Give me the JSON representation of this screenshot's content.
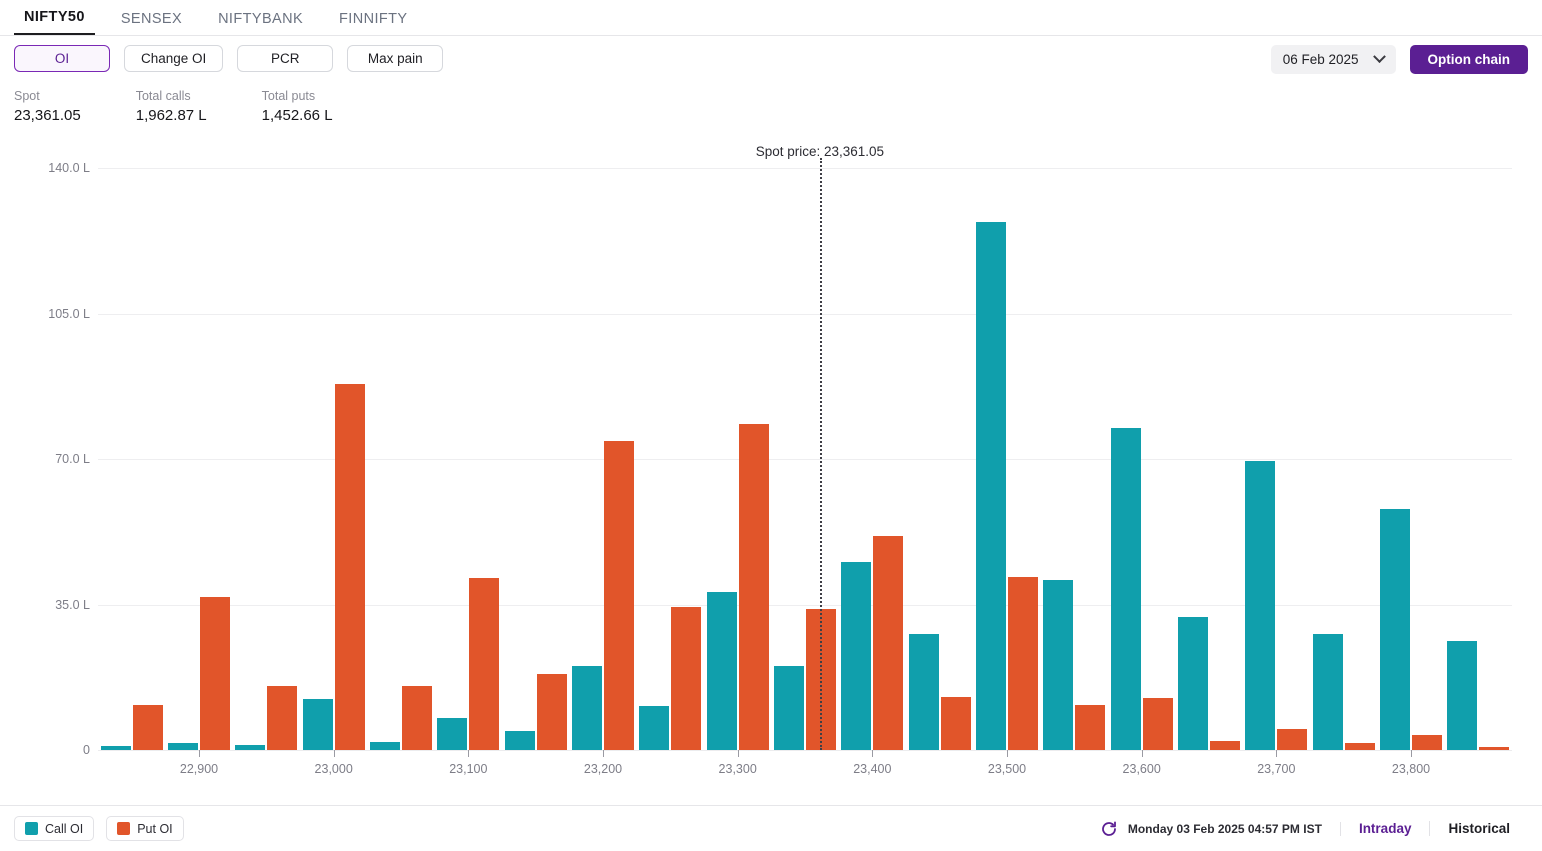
{
  "tabs": [
    {
      "label": "NIFTY50",
      "active": true
    },
    {
      "label": "SENSEX",
      "active": false
    },
    {
      "label": "NIFTYBANK",
      "active": false
    },
    {
      "label": "FINNIFTY",
      "active": false
    }
  ],
  "metric_buttons": [
    {
      "label": "OI",
      "active": true
    },
    {
      "label": "Change OI",
      "active": false
    },
    {
      "label": "PCR",
      "active": false
    },
    {
      "label": "Max pain",
      "active": false
    }
  ],
  "expiry": {
    "label": "06 Feb 2025",
    "icon": "chevron-down-icon"
  },
  "option_chain_button": {
    "label": "Option chain"
  },
  "stats": [
    {
      "label": "Spot",
      "value": "23,361.05"
    },
    {
      "label": "Total calls",
      "value": "1,962.87 L"
    },
    {
      "label": "Total puts",
      "value": "1,452.66 L"
    }
  ],
  "colors": {
    "call": "#109FAC",
    "put": "#E1552A",
    "accent": "#5B1F93",
    "spot_line": "#3F3F46"
  },
  "legend": [
    {
      "label": "Call OI",
      "color": "#109FAC"
    },
    {
      "label": "Put OI",
      "color": "#E1552A"
    }
  ],
  "footer": {
    "refresh_icon": "refresh-icon",
    "timestamp": "Monday 03 Feb 2025 04:57 PM IST",
    "views": [
      {
        "label": "Intraday",
        "active": true
      },
      {
        "label": "Historical",
        "active": false
      }
    ]
  },
  "chart_data": {
    "type": "bar",
    "title": "",
    "xlabel": "",
    "ylabel": "",
    "ylim": [
      0,
      140
    ],
    "y_unit": "L",
    "y_ticks": [
      0,
      35,
      70,
      105,
      140
    ],
    "y_tick_labels": [
      "0",
      "35.0 L",
      "70.0 L",
      "105.0 L",
      "140.0 L"
    ],
    "grid": true,
    "legend_position": "bottom-left",
    "x_tick_labels": [
      "22,900",
      "23,000",
      "23,100",
      "23,200",
      "23,300",
      "23,400",
      "23,500",
      "23,600",
      "23,700",
      "23,800"
    ],
    "x_tick_strikes": [
      22900,
      23000,
      23100,
      23200,
      23300,
      23400,
      23500,
      23600,
      23700,
      23800
    ],
    "categories": [
      22850,
      22900,
      22950,
      23000,
      23050,
      23100,
      23150,
      23200,
      23250,
      23300,
      23350,
      23400,
      23450,
      23500,
      23550,
      23600,
      23650,
      23700,
      23750,
      23800,
      23850
    ],
    "series": [
      {
        "name": "Call OI",
        "color": "#109FAC",
        "values": [
          0.9,
          1.6,
          1.3,
          12.2,
          2.0,
          7.6,
          4.6,
          20.2,
          10.7,
          38.0,
          20.1,
          45.2,
          27.8,
          127.0,
          40.9,
          77.5,
          32.1,
          69.6,
          27.9,
          58.0,
          26.3
        ]
      },
      {
        "name": "Put OI",
        "color": "#E1552A",
        "values": [
          10.8,
          36.8,
          15.4,
          88.0,
          15.5,
          41.4,
          18.3,
          74.3,
          34.3,
          78.5,
          34.0,
          51.6,
          12.8,
          41.7,
          10.9,
          12.5,
          2.2,
          5.1,
          1.7,
          3.6,
          0.8
        ]
      }
    ],
    "annotations": [
      {
        "type": "vline",
        "label": "Spot price: 23,361.05",
        "value": 23361.05,
        "style": "dotted"
      }
    ]
  }
}
